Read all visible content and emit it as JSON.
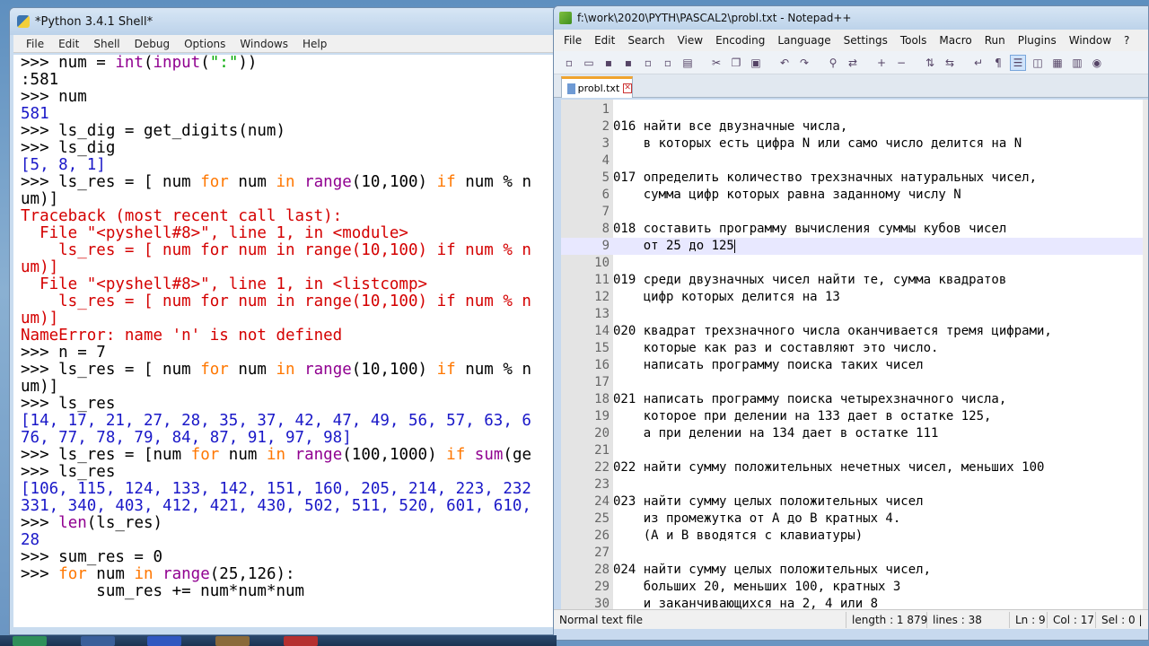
{
  "python_shell": {
    "title": "*Python 3.4.1 Shell*",
    "menu": [
      "File",
      "Edit",
      "Shell",
      "Debug",
      "Options",
      "Windows",
      "Help"
    ],
    "lines": [
      {
        "t": "in",
        "segs": [
          [
            ">>> num = ",
            ""
          ],
          [
            "int",
            "bi"
          ],
          [
            "(",
            ""
          ],
          [
            "input",
            "bi"
          ],
          [
            "(",
            ""
          ],
          [
            "\":\"",
            "st"
          ],
          [
            "))",
            ""
          ]
        ]
      },
      {
        "t": "in",
        "segs": [
          [
            ":581",
            ""
          ]
        ]
      },
      {
        "t": "in",
        "segs": [
          [
            ">>> num",
            ""
          ]
        ]
      },
      {
        "t": "out",
        "segs": [
          [
            "581",
            "c-out"
          ]
        ]
      },
      {
        "t": "in",
        "segs": [
          [
            ">>> ls_dig = get_digits(num)",
            ""
          ]
        ]
      },
      {
        "t": "in",
        "segs": [
          [
            ">>> ls_dig",
            ""
          ]
        ]
      },
      {
        "t": "out",
        "segs": [
          [
            "[5, 8, 1]",
            "c-out"
          ]
        ]
      },
      {
        "t": "in",
        "segs": [
          [
            ">>> ls_res = [ num ",
            ""
          ],
          [
            "for",
            "kw"
          ],
          [
            " num ",
            ""
          ],
          [
            "in",
            "kw"
          ],
          [
            " ",
            ""
          ],
          [
            "range",
            "bi"
          ],
          [
            "(10,100) ",
            ""
          ],
          [
            "if",
            "kw"
          ],
          [
            " num % n",
            ""
          ]
        ]
      },
      {
        "t": "in",
        "segs": [
          [
            "um)]",
            ""
          ]
        ]
      },
      {
        "t": "err",
        "segs": [
          [
            "Traceback (most recent call last):",
            "c-err"
          ]
        ]
      },
      {
        "t": "err",
        "segs": [
          [
            "  File \"<pyshell#8>\", line 1, in <module>",
            "c-err"
          ]
        ]
      },
      {
        "t": "err",
        "segs": [
          [
            "    ls_res = [ num for num in range(10,100) if num % n",
            "c-err"
          ]
        ]
      },
      {
        "t": "err",
        "segs": [
          [
            "um)]",
            "c-err"
          ]
        ]
      },
      {
        "t": "err",
        "segs": [
          [
            "  File \"<pyshell#8>\", line 1, in <listcomp>",
            "c-err"
          ]
        ]
      },
      {
        "t": "err",
        "segs": [
          [
            "    ls_res = [ num for num in range(10,100) if num % n",
            "c-err"
          ]
        ]
      },
      {
        "t": "err",
        "segs": [
          [
            "um)]",
            "c-err"
          ]
        ]
      },
      {
        "t": "err",
        "segs": [
          [
            "NameError: name 'n' is not defined",
            "c-err"
          ]
        ]
      },
      {
        "t": "in",
        "segs": [
          [
            ">>> n = 7",
            ""
          ]
        ]
      },
      {
        "t": "in",
        "segs": [
          [
            ">>> ls_res = [ num ",
            ""
          ],
          [
            "for",
            "kw"
          ],
          [
            " num ",
            ""
          ],
          [
            "in",
            "kw"
          ],
          [
            " ",
            ""
          ],
          [
            "range",
            "bi"
          ],
          [
            "(10,100) ",
            ""
          ],
          [
            "if",
            "kw"
          ],
          [
            " num % n",
            ""
          ]
        ]
      },
      {
        "t": "in",
        "segs": [
          [
            "um)]",
            ""
          ]
        ]
      },
      {
        "t": "in",
        "segs": [
          [
            ">>> ls_res",
            ""
          ]
        ]
      },
      {
        "t": "out",
        "segs": [
          [
            "[14, 17, 21, 27, 28, 35, 37, 42, 47, 49, 56, 57, 63, 6",
            "c-out"
          ]
        ]
      },
      {
        "t": "out",
        "segs": [
          [
            "76, 77, 78, 79, 84, 87, 91, 97, 98]",
            "c-out"
          ]
        ]
      },
      {
        "t": "in",
        "segs": [
          [
            ">>> ls_res = [num ",
            ""
          ],
          [
            "for",
            "kw"
          ],
          [
            " num ",
            ""
          ],
          [
            "in",
            "kw"
          ],
          [
            " ",
            ""
          ],
          [
            "range",
            "bi"
          ],
          [
            "(100,1000) ",
            ""
          ],
          [
            "if",
            "kw"
          ],
          [
            " ",
            ""
          ],
          [
            "sum",
            "bi"
          ],
          [
            "(ge",
            ""
          ]
        ]
      },
      {
        "t": "in",
        "segs": [
          [
            ">>> ls_res",
            ""
          ]
        ]
      },
      {
        "t": "out",
        "segs": [
          [
            "[106, 115, 124, 133, 142, 151, 160, 205, 214, 223, 232",
            "c-out"
          ]
        ]
      },
      {
        "t": "out",
        "segs": [
          [
            "331, 340, 403, 412, 421, 430, 502, 511, 520, 601, 610,",
            "c-out"
          ]
        ]
      },
      {
        "t": "in",
        "segs": [
          [
            ">>> ",
            ""
          ],
          [
            "len",
            "bi"
          ],
          [
            "(ls_res)",
            ""
          ]
        ]
      },
      {
        "t": "out",
        "segs": [
          [
            "28",
            "c-out"
          ]
        ]
      },
      {
        "t": "in",
        "segs": [
          [
            ">>> sum_res = 0",
            ""
          ]
        ]
      },
      {
        "t": "in",
        "segs": [
          [
            ">>> ",
            ""
          ],
          [
            "for",
            "kw"
          ],
          [
            " num ",
            ""
          ],
          [
            "in",
            "kw"
          ],
          [
            " ",
            ""
          ],
          [
            "range",
            "bi"
          ],
          [
            "(25,126):",
            ""
          ]
        ]
      },
      {
        "t": "in",
        "segs": [
          [
            "        sum_res += num*num*num",
            ""
          ]
        ]
      }
    ]
  },
  "notepad": {
    "title": "f:\\work\\2020\\PYTH\\PASCAL2\\probl.txt - Notepad++",
    "menu": [
      "File",
      "Edit",
      "Search",
      "View",
      "Encoding",
      "Language",
      "Settings",
      "Tools",
      "Macro",
      "Run",
      "Plugins",
      "Window",
      "?"
    ],
    "tab_label": "probl.txt",
    "current_line": 9,
    "lines": [
      {
        "n": "1",
        "text": ""
      },
      {
        "n": "2",
        "text": "016 найти все двузначные числа,"
      },
      {
        "n": "3",
        "text": "    в которых есть цифра N или само число делится на N"
      },
      {
        "n": "4",
        "text": ""
      },
      {
        "n": "5",
        "text": "017 определить количество трехзначных натуральных чисел,"
      },
      {
        "n": "6",
        "text": "    сумма цифр которых равна заданному числу N"
      },
      {
        "n": "7",
        "text": ""
      },
      {
        "n": "8",
        "text": "018 составить программу вычисления суммы кубов чисел"
      },
      {
        "n": "9",
        "text": "    от 25 до 125"
      },
      {
        "n": "10",
        "text": ""
      },
      {
        "n": "11",
        "text": "019 среди двузначных чисел найти те, сумма квадратов"
      },
      {
        "n": "12",
        "text": "    цифр которых делится на 13"
      },
      {
        "n": "13",
        "text": ""
      },
      {
        "n": "14",
        "text": "020 квадрат трехзначного числа оканчивается тремя цифрами,"
      },
      {
        "n": "15",
        "text": "    которые как раз и составляют это число."
      },
      {
        "n": "16",
        "text": "    написать программу поиска таких чисел"
      },
      {
        "n": "17",
        "text": ""
      },
      {
        "n": "18",
        "text": "021 написать программу поиска четырехзначного числа,"
      },
      {
        "n": "19",
        "text": "    которое при делении на 133 дает в остатке 125,"
      },
      {
        "n": "20",
        "text": "    а при делении на 134 дает в остатке 111"
      },
      {
        "n": "21",
        "text": ""
      },
      {
        "n": "22",
        "text": "022 найти сумму положительных нечетных чисел, меньших 100"
      },
      {
        "n": "23",
        "text": ""
      },
      {
        "n": "24",
        "text": "023 найти сумму целых положительных чисел"
      },
      {
        "n": "25",
        "text": "    из промежутка от А до В кратных 4."
      },
      {
        "n": "26",
        "text": "    (А и В вводятся с клавиатуры)"
      },
      {
        "n": "27",
        "text": ""
      },
      {
        "n": "28",
        "text": "024 найти сумму целых положительных чисел,"
      },
      {
        "n": "29",
        "text": "    больших 20, меньших 100, кратных 3"
      },
      {
        "n": "30",
        "text": "    и заканчивающихся на 2, 4 или 8"
      }
    ],
    "status": {
      "type": "Normal text file",
      "length": "length : 1 879",
      "lines": "lines : 38",
      "ln": "Ln : 9",
      "col": "Col : 17",
      "sel": "Sel : 0 |"
    }
  }
}
